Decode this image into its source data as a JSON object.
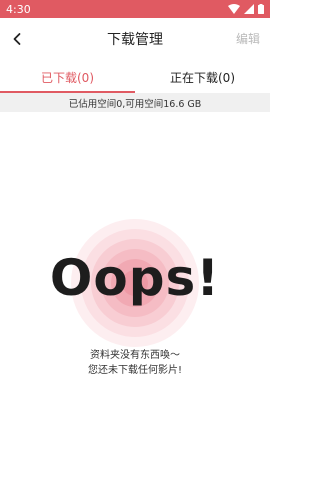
{
  "status_bar": {
    "time": "4:30"
  },
  "nav": {
    "title": "下载管理",
    "edit_label": "编辑"
  },
  "tabs": [
    {
      "label": "已下载(0)",
      "active": true
    },
    {
      "label": "正在下载(0)",
      "active": false
    }
  ],
  "storage": {
    "text": "已佔用空间0,可用空间16.6 GB"
  },
  "empty": {
    "headline": "Oops!",
    "line1": "资料夹没有东西喚～",
    "line2": "您还未下载任何影片!"
  },
  "colors": {
    "accent": "#e05a62"
  }
}
